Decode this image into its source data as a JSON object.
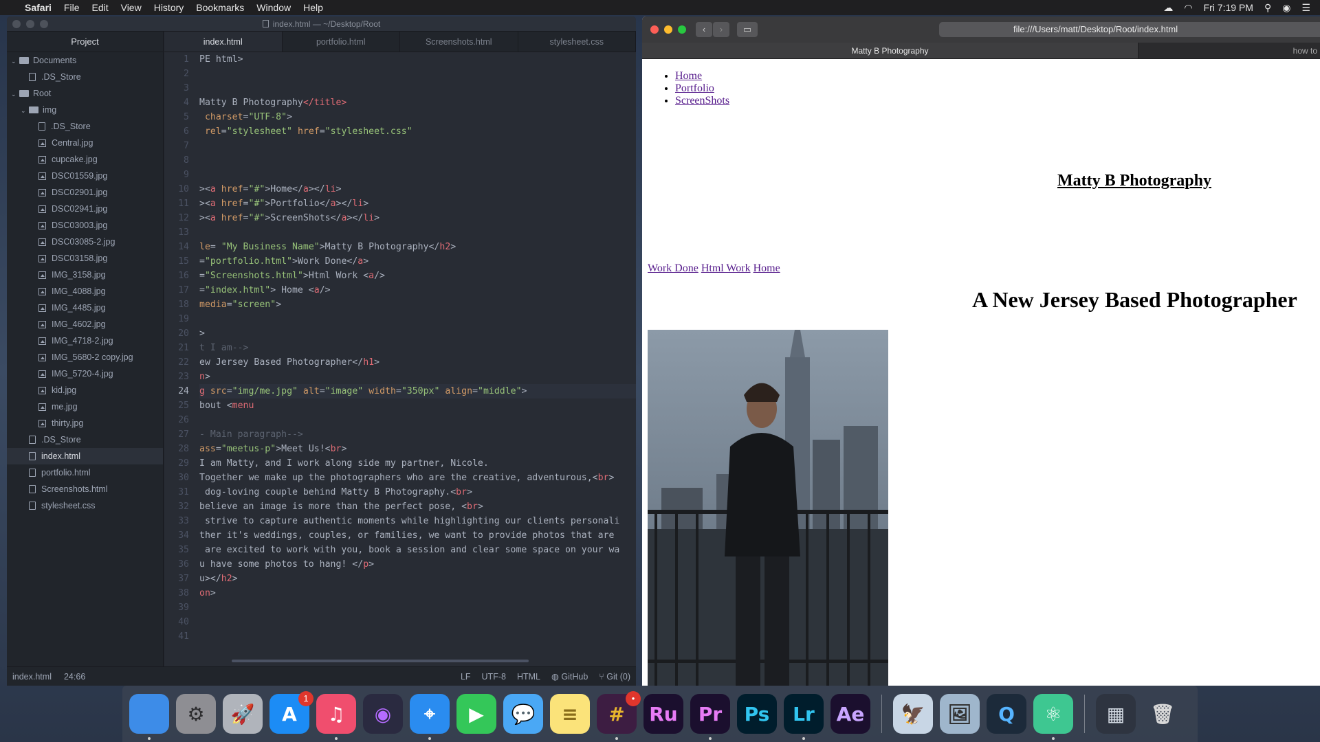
{
  "menubar": {
    "app": "Safari",
    "items": [
      "File",
      "Edit",
      "View",
      "History",
      "Bookmarks",
      "Window",
      "Help"
    ],
    "clock": "Fri 7:19 PM"
  },
  "atom": {
    "window_title": "index.html — ~/Desktop/Root",
    "tree": {
      "header": "Project",
      "rows": [
        {
          "label": "Documents",
          "kind": "folder",
          "depth": 0
        },
        {
          "label": ".DS_Store",
          "kind": "file",
          "depth": 1
        },
        {
          "label": "Root",
          "kind": "folder",
          "depth": 0
        },
        {
          "label": "img",
          "kind": "folder",
          "depth": 1
        },
        {
          "label": ".DS_Store",
          "kind": "file",
          "depth": 2
        },
        {
          "label": "Central.jpg",
          "kind": "image",
          "depth": 2
        },
        {
          "label": "cupcake.jpg",
          "kind": "image",
          "depth": 2
        },
        {
          "label": "DSC01559.jpg",
          "kind": "image",
          "depth": 2
        },
        {
          "label": "DSC02901.jpg",
          "kind": "image",
          "depth": 2
        },
        {
          "label": "DSC02941.jpg",
          "kind": "image",
          "depth": 2
        },
        {
          "label": "DSC03003.jpg",
          "kind": "image",
          "depth": 2
        },
        {
          "label": "DSC03085-2.jpg",
          "kind": "image",
          "depth": 2
        },
        {
          "label": "DSC03158.jpg",
          "kind": "image",
          "depth": 2
        },
        {
          "label": "IMG_3158.jpg",
          "kind": "image",
          "depth": 2
        },
        {
          "label": "IMG_4088.jpg",
          "kind": "image",
          "depth": 2
        },
        {
          "label": "IMG_4485.jpg",
          "kind": "image",
          "depth": 2
        },
        {
          "label": "IMG_4602.jpg",
          "kind": "image",
          "depth": 2
        },
        {
          "label": "IMG_4718-2.jpg",
          "kind": "image",
          "depth": 2
        },
        {
          "label": "IMG_5680-2 copy.jpg",
          "kind": "image",
          "depth": 2
        },
        {
          "label": "IMG_5720-4.jpg",
          "kind": "image",
          "depth": 2
        },
        {
          "label": "kid.jpg",
          "kind": "image",
          "depth": 2
        },
        {
          "label": "me.jpg",
          "kind": "image",
          "depth": 2
        },
        {
          "label": "thirty.jpg",
          "kind": "image",
          "depth": 2
        },
        {
          "label": ".DS_Store",
          "kind": "file",
          "depth": 1
        },
        {
          "label": "index.html",
          "kind": "file",
          "depth": 1,
          "selected": true
        },
        {
          "label": "portfolio.html",
          "kind": "file",
          "depth": 1
        },
        {
          "label": "Screenshots.html",
          "kind": "file",
          "depth": 1
        },
        {
          "label": "stylesheet.css",
          "kind": "file",
          "depth": 1
        }
      ]
    },
    "tabs": [
      "index.html",
      "portfolio.html",
      "Screenshots.html",
      "stylesheet.css"
    ],
    "active_tab": 0,
    "current_line": 24,
    "code_lines": [
      [
        {
          "t": "PE html>",
          "c": "#abb2bf"
        }
      ],
      [],
      [],
      [
        {
          "t": "Matty B Photography",
          "c": "#abb2bf"
        },
        {
          "t": "</title>",
          "c": "#e06c75"
        }
      ],
      [
        {
          "t": " charset",
          "c": "#d19a66"
        },
        {
          "t": "=",
          "c": "#abb2bf"
        },
        {
          "t": "\"UTF-8\"",
          "c": "#98c379"
        },
        {
          "t": ">",
          "c": "#abb2bf"
        }
      ],
      [
        {
          "t": " rel",
          "c": "#d19a66"
        },
        {
          "t": "=",
          "c": "#abb2bf"
        },
        {
          "t": "\"stylesheet\"",
          "c": "#98c379"
        },
        {
          "t": " href",
          "c": "#d19a66"
        },
        {
          "t": "=",
          "c": "#abb2bf"
        },
        {
          "t": "\"stylesheet.css\"",
          "c": "#98c379"
        }
      ],
      [],
      [],
      [],
      [
        {
          "t": "><",
          "c": "#abb2bf"
        },
        {
          "t": "a",
          "c": "#e06c75"
        },
        {
          "t": " href",
          "c": "#d19a66"
        },
        {
          "t": "=",
          "c": "#abb2bf"
        },
        {
          "t": "\"#\"",
          "c": "#98c379"
        },
        {
          "t": ">Home</",
          "c": "#abb2bf"
        },
        {
          "t": "a",
          "c": "#e06c75"
        },
        {
          "t": "></",
          "c": "#abb2bf"
        },
        {
          "t": "li",
          "c": "#e06c75"
        },
        {
          "t": ">",
          "c": "#abb2bf"
        }
      ],
      [
        {
          "t": "><",
          "c": "#abb2bf"
        },
        {
          "t": "a",
          "c": "#e06c75"
        },
        {
          "t": " href",
          "c": "#d19a66"
        },
        {
          "t": "=",
          "c": "#abb2bf"
        },
        {
          "t": "\"#\"",
          "c": "#98c379"
        },
        {
          "t": ">Portfolio</",
          "c": "#abb2bf"
        },
        {
          "t": "a",
          "c": "#e06c75"
        },
        {
          "t": "></",
          "c": "#abb2bf"
        },
        {
          "t": "li",
          "c": "#e06c75"
        },
        {
          "t": ">",
          "c": "#abb2bf"
        }
      ],
      [
        {
          "t": "><",
          "c": "#abb2bf"
        },
        {
          "t": "a",
          "c": "#e06c75"
        },
        {
          "t": " href",
          "c": "#d19a66"
        },
        {
          "t": "=",
          "c": "#abb2bf"
        },
        {
          "t": "\"#\"",
          "c": "#98c379"
        },
        {
          "t": ">ScreenShots</",
          "c": "#abb2bf"
        },
        {
          "t": "a",
          "c": "#e06c75"
        },
        {
          "t": "></",
          "c": "#abb2bf"
        },
        {
          "t": "li",
          "c": "#e06c75"
        },
        {
          "t": ">",
          "c": "#abb2bf"
        }
      ],
      [],
      [
        {
          "t": "le",
          "c": "#d19a66"
        },
        {
          "t": "= ",
          "c": "#abb2bf"
        },
        {
          "t": "\"My Business Name\"",
          "c": "#98c379"
        },
        {
          "t": ">Matty B Photography</",
          "c": "#abb2bf"
        },
        {
          "t": "h2",
          "c": "#e06c75"
        },
        {
          "t": ">",
          "c": "#abb2bf"
        }
      ],
      [
        {
          "t": "=",
          "c": "#abb2bf"
        },
        {
          "t": "\"portfolio.html\"",
          "c": "#98c379"
        },
        {
          "t": ">Work Done</",
          "c": "#abb2bf"
        },
        {
          "t": "a",
          "c": "#e06c75"
        },
        {
          "t": ">",
          "c": "#abb2bf"
        }
      ],
      [
        {
          "t": "=",
          "c": "#abb2bf"
        },
        {
          "t": "\"Screenshots.html\"",
          "c": "#98c379"
        },
        {
          "t": ">Html Work <",
          "c": "#abb2bf"
        },
        {
          "t": "a",
          "c": "#e06c75"
        },
        {
          "t": "/>",
          "c": "#abb2bf"
        }
      ],
      [
        {
          "t": "=",
          "c": "#abb2bf"
        },
        {
          "t": "\"index.html\"",
          "c": "#98c379"
        },
        {
          "t": "> Home <",
          "c": "#abb2bf"
        },
        {
          "t": "a",
          "c": "#e06c75"
        },
        {
          "t": "/>",
          "c": "#abb2bf"
        }
      ],
      [
        {
          "t": "media",
          "c": "#d19a66"
        },
        {
          "t": "=",
          "c": "#abb2bf"
        },
        {
          "t": "\"screen\"",
          "c": "#98c379"
        },
        {
          "t": ">",
          "c": "#abb2bf"
        }
      ],
      [],
      [
        {
          "t": ">",
          "c": "#abb2bf"
        }
      ],
      [
        {
          "t": "t I am-->",
          "c": "#5c6370"
        }
      ],
      [
        {
          "t": "ew Jersey Based Photographer</",
          "c": "#abb2bf"
        },
        {
          "t": "h1",
          "c": "#e06c75"
        },
        {
          "t": ">",
          "c": "#abb2bf"
        }
      ],
      [
        {
          "t": "n",
          "c": "#e06c75"
        },
        {
          "t": ">",
          "c": "#abb2bf"
        }
      ],
      [
        {
          "t": "g",
          "c": "#e06c75"
        },
        {
          "t": " src",
          "c": "#d19a66"
        },
        {
          "t": "=",
          "c": "#abb2bf"
        },
        {
          "t": "\"img/me.jpg\"",
          "c": "#98c379"
        },
        {
          "t": " alt",
          "c": "#d19a66"
        },
        {
          "t": "=",
          "c": "#abb2bf"
        },
        {
          "t": "\"image\"",
          "c": "#98c379"
        },
        {
          "t": " width",
          "c": "#d19a66"
        },
        {
          "t": "=",
          "c": "#abb2bf"
        },
        {
          "t": "\"350px\"",
          "c": "#98c379"
        },
        {
          "t": " align",
          "c": "#d19a66"
        },
        {
          "t": "=",
          "c": "#abb2bf"
        },
        {
          "t": "\"middle\"",
          "c": "#98c379"
        },
        {
          "t": ">",
          "c": "#abb2bf"
        }
      ],
      [
        {
          "t": "bout <",
          "c": "#abb2bf"
        },
        {
          "t": "menu",
          "c": "#e06c75"
        }
      ],
      [],
      [
        {
          "t": "- Main paragraph-->",
          "c": "#5c6370"
        }
      ],
      [
        {
          "t": "ass",
          "c": "#d19a66"
        },
        {
          "t": "=",
          "c": "#abb2bf"
        },
        {
          "t": "\"meetus-p\"",
          "c": "#98c379"
        },
        {
          "t": ">Meet Us!<",
          "c": "#abb2bf"
        },
        {
          "t": "br",
          "c": "#e06c75"
        },
        {
          "t": ">",
          "c": "#abb2bf"
        }
      ],
      [
        {
          "t": "I am Matty, and I work along side my partner, Nicole.",
          "c": "#abb2bf"
        }
      ],
      [
        {
          "t": "Together we make up the photographers who are the creative, adventurous,<",
          "c": "#abb2bf"
        },
        {
          "t": "br",
          "c": "#e06c75"
        },
        {
          "t": ">",
          "c": "#abb2bf"
        }
      ],
      [
        {
          "t": " dog-loving couple behind Matty B Photography.<",
          "c": "#abb2bf"
        },
        {
          "t": "br",
          "c": "#e06c75"
        },
        {
          "t": ">",
          "c": "#abb2bf"
        }
      ],
      [
        {
          "t": "believe an image is more than the perfect pose, <",
          "c": "#abb2bf"
        },
        {
          "t": "br",
          "c": "#e06c75"
        },
        {
          "t": ">",
          "c": "#abb2bf"
        }
      ],
      [
        {
          "t": " strive to capture authentic moments while highlighting our clients personali",
          "c": "#abb2bf"
        }
      ],
      [
        {
          "t": "ther it's weddings, couples, or families, we want to provide photos that are",
          "c": "#abb2bf"
        }
      ],
      [
        {
          "t": " are excited to work with you, book a session and clear some space on your wa",
          "c": "#abb2bf"
        }
      ],
      [
        {
          "t": "u have some photos to hang! </",
          "c": "#abb2bf"
        },
        {
          "t": "p",
          "c": "#e06c75"
        },
        {
          "t": ">",
          "c": "#abb2bf"
        }
      ],
      [
        {
          "t": "u></",
          "c": "#abb2bf"
        },
        {
          "t": "h2",
          "c": "#e06c75"
        },
        {
          "t": ">",
          "c": "#abb2bf"
        }
      ],
      [
        {
          "t": "on",
          "c": "#e06c75"
        },
        {
          "t": ">",
          "c": "#abb2bf"
        }
      ],
      [],
      [],
      []
    ],
    "status": {
      "file": "index.html",
      "cursor": "24:66",
      "line_ending": "LF",
      "encoding": "UTF-8",
      "grammar": "HTML",
      "github": "GitHub",
      "git": "Git (0)"
    }
  },
  "safari": {
    "url": "file:///Users/matt/Desktop/Root/index.html",
    "tab_active": "Matty B Photography",
    "tab_other": "how to",
    "page": {
      "nav": [
        "Home",
        "Portfolio",
        "ScreenShots"
      ],
      "business_name": "Matty B Photography",
      "links": [
        "Work Done",
        "Html Work",
        "Home"
      ],
      "tagline": "A New Jersey Based Photographer"
    }
  },
  "dock": {
    "apps": [
      {
        "name": "finder-icon",
        "label": "",
        "bg": "#3d8ce8",
        "fg": "#ffffff",
        "dot": true
      },
      {
        "name": "system-preferences-icon",
        "label": "⚙",
        "bg": "#8e8e93",
        "fg": "#2c2c2e",
        "dot": false
      },
      {
        "name": "launchpad-icon",
        "label": "🚀",
        "bg": "#b0b4bb",
        "fg": "#333333",
        "dot": false
      },
      {
        "name": "app-store-icon",
        "label": "A",
        "bg": "#1c8cf5",
        "fg": "#ffffff",
        "dot": false,
        "badge": "1"
      },
      {
        "name": "music-icon",
        "label": "♫",
        "bg": "#f04e6e",
        "fg": "#ffffff",
        "dot": true
      },
      {
        "name": "siri-icon",
        "label": "◉",
        "bg": "#2a2a40",
        "fg": "#b46bff",
        "dot": false
      },
      {
        "name": "safari-icon",
        "label": "⌖",
        "bg": "#2a8cf0",
        "fg": "#ffffff",
        "dot": true
      },
      {
        "name": "facetime-icon",
        "label": "▶",
        "bg": "#34c759",
        "fg": "#ffffff",
        "dot": false
      },
      {
        "name": "messages-icon",
        "label": "💬",
        "bg": "#4aa8f5",
        "fg": "#ffffff",
        "dot": false
      },
      {
        "name": "notes-icon",
        "label": "≡",
        "bg": "#fbe37a",
        "fg": "#8a6d1a",
        "dot": false
      },
      {
        "name": "slack-icon",
        "label": "#",
        "bg": "#3d1d42",
        "fg": "#e8b52d",
        "dot": true,
        "badge": "•"
      },
      {
        "name": "rush-icon",
        "label": "Ru",
        "bg": "#1b0f2e",
        "fg": "#e77bf5",
        "dot": false
      },
      {
        "name": "premiere-icon",
        "label": "Pr",
        "bg": "#1b0f2e",
        "fg": "#e77bf5",
        "dot": true
      },
      {
        "name": "photoshop-icon",
        "label": "Ps",
        "bg": "#001d2c",
        "fg": "#31c5f0",
        "dot": false
      },
      {
        "name": "lightroom-icon",
        "label": "Lr",
        "bg": "#001d2c",
        "fg": "#31c5f0",
        "dot": true
      },
      {
        "name": "after-effects-icon",
        "label": "Ae",
        "bg": "#1b0f2e",
        "fg": "#c9a5ff",
        "dot": false
      },
      {
        "name": "preview-icon",
        "label": "🦅",
        "bg": "#c8d6e5",
        "fg": "#333333",
        "dot": false
      },
      {
        "name": "image-capture-icon",
        "label": "🖼",
        "bg": "#9fb6cc",
        "fg": "#333333",
        "dot": false
      },
      {
        "name": "quicktime-icon",
        "label": "Q",
        "bg": "#1c2a3a",
        "fg": "#56b4ff",
        "dot": false
      },
      {
        "name": "atom-icon",
        "label": "⚛",
        "bg": "#3ec791",
        "fg": "#ffffff",
        "dot": true
      },
      {
        "name": "screenshot-stack-icon",
        "label": "▦",
        "bg": "#2e3440",
        "fg": "#cfd6df",
        "dot": false
      },
      {
        "name": "trash-icon",
        "label": "🗑",
        "bg": "transparent",
        "fg": "#d8d8d8",
        "dot": false
      }
    ]
  }
}
